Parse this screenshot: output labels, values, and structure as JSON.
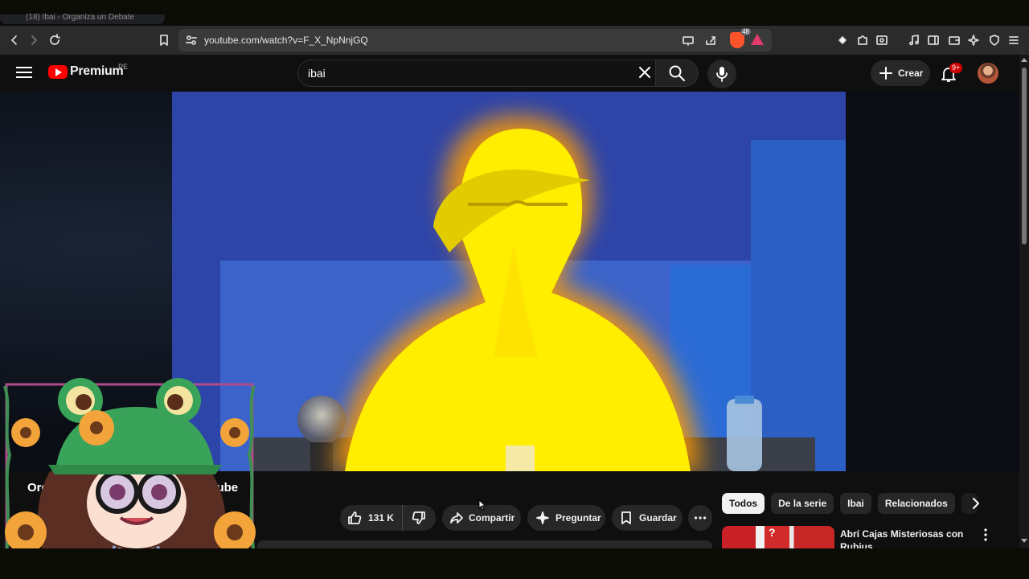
{
  "browser": {
    "tab_title": "(18) Ibai - Organiza un Debate",
    "url": "youtube.com/watch?v=F_X_NpNnjGQ",
    "shields_count": "48"
  },
  "header": {
    "logo_text": "Premium",
    "region": "PE",
    "search_value": "ibai",
    "create_label": "Crear",
    "notifications_badge": "9+"
  },
  "video": {
    "title_partial": "Orga",
    "title_partial_end": "e Youtube",
    "like_count": "131 K",
    "share_label": "Compartir",
    "ask_label": "Preguntar",
    "save_label": "Guardar"
  },
  "sidebar": {
    "chips": [
      "Todos",
      "De la serie",
      "Ibai",
      "Relacionados"
    ],
    "recommended": [
      {
        "title": "Abrí Cajas Misteriosas con Rubius"
      }
    ]
  },
  "colors": {
    "accent": "#ff0000",
    "background": "#0f0f0f",
    "chip_active": "#f1f1f1",
    "badge": "#cc0000"
  },
  "icons": {
    "back": "back-arrow-icon",
    "forward": "forward-arrow-icon",
    "reload": "reload-icon",
    "bookmark": "bookmark-icon",
    "menu": "hamburger-menu-icon",
    "search": "search-icon",
    "mic": "microphone-icon",
    "bell": "bell-icon"
  }
}
